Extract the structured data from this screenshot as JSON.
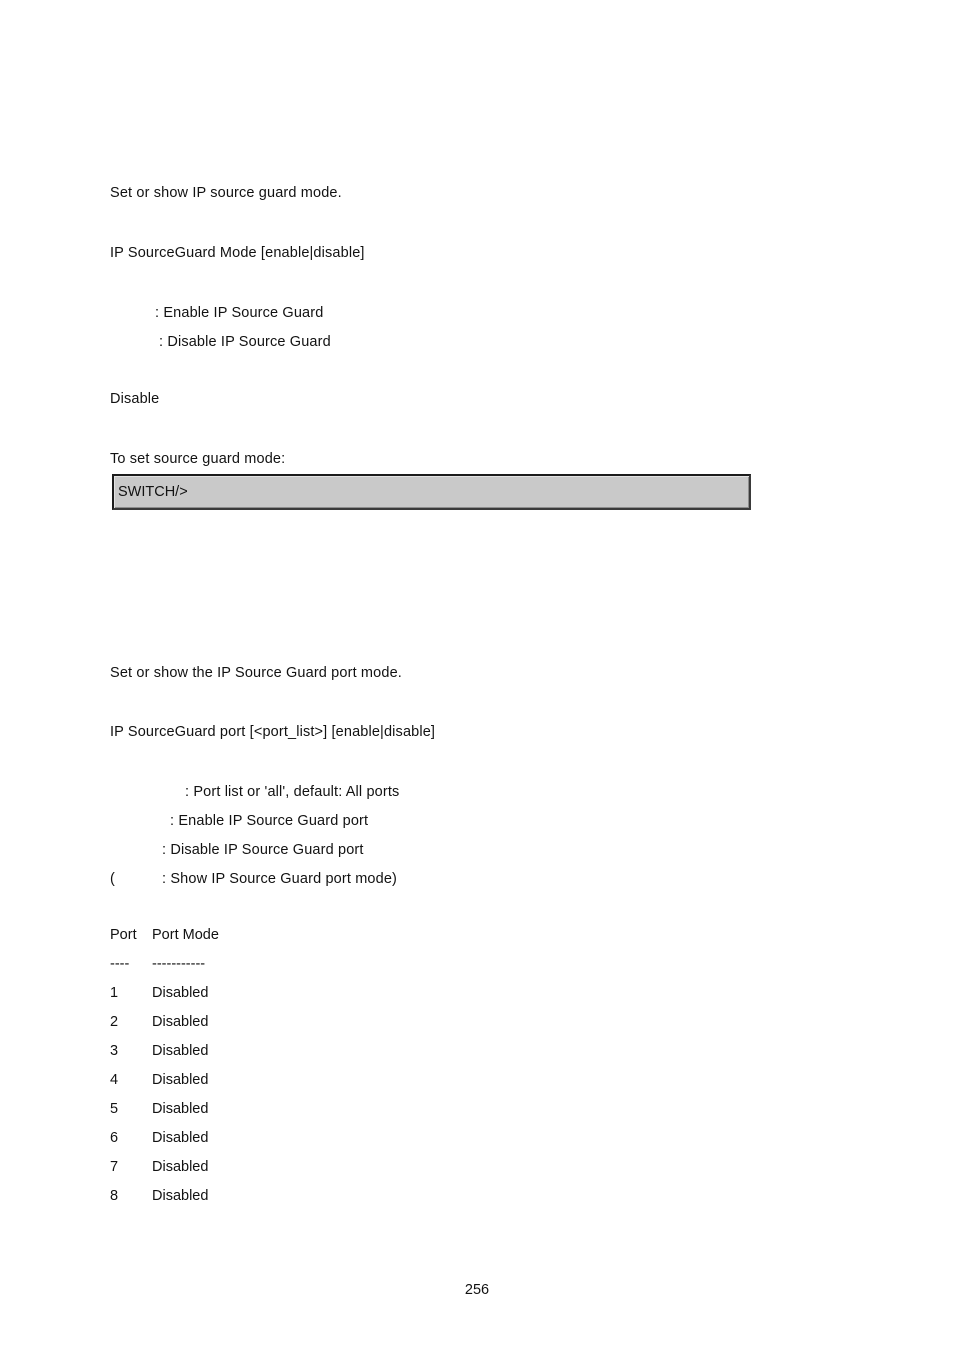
{
  "document": {
    "page_number": "256",
    "background_color": "#ffffff",
    "text_color": "#121212"
  },
  "section_mode": {
    "description": "Set or show IP source guard mode.",
    "syntax": "IP SourceGuard Mode [enable|disable]",
    "parameters": [
      ": Enable IP Source Guard",
      ": Disable IP Source Guard"
    ],
    "default_value": "Disable",
    "example_label": "To set source guard mode:",
    "console": {
      "prompt": "SWITCH/>",
      "background_color": "#c9c9c9",
      "border_color": "#1c1c1c"
    }
  },
  "section_port": {
    "description": "Set or show the IP Source Guard port mode.",
    "syntax": "IP SourceGuard port [<port_list>] [enable|disable]",
    "parameters": [
      ": Port list or 'all', default: All ports",
      ": Enable IP Source Guard port",
      ": Disable IP Source Guard port",
      "(",
      ": Show IP Source Guard port mode)"
    ],
    "table": {
      "headers": [
        "Port",
        "Port Mode"
      ],
      "rule": [
        "----",
        "-----------"
      ],
      "rows": [
        {
          "port": "1",
          "mode": "Disabled"
        },
        {
          "port": "2",
          "mode": "Disabled"
        },
        {
          "port": "3",
          "mode": "Disabled"
        },
        {
          "port": "4",
          "mode": "Disabled"
        },
        {
          "port": "5",
          "mode": "Disabled"
        },
        {
          "port": "6",
          "mode": "Disabled"
        },
        {
          "port": "7",
          "mode": "Disabled"
        },
        {
          "port": "8",
          "mode": "Disabled"
        }
      ]
    }
  }
}
